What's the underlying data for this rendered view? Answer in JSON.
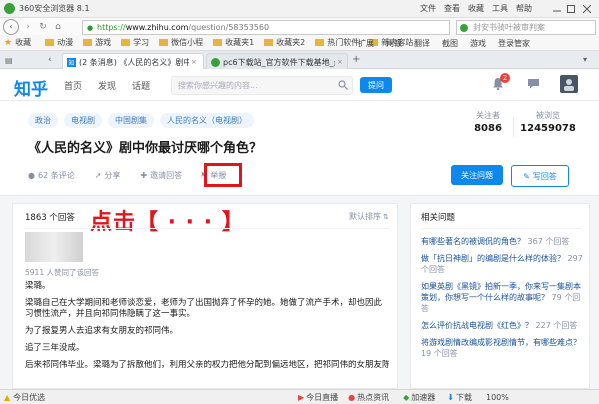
{
  "browser": {
    "title": "360安全浏览器 8.1",
    "menus": [
      "文件",
      "查看",
      "收藏",
      "工具",
      "帮助"
    ],
    "url_scheme": "https://",
    "url_domain": "www.zhihu.com",
    "url_path": "/question/58353560",
    "search_placeholder": "封安书骑叶被审判案",
    "bookmarks": [
      "收藏",
      "动漫",
      "游戏",
      "学习",
      "微信小程",
      "收藏夹1",
      "收藏夹2",
      "热门软件",
      "新内容站"
    ],
    "toolbar_right": [
      "扩展",
      "网银",
      "翻译",
      "截图",
      "游戏",
      "登录管家"
    ],
    "tabs": [
      "(2 条消息) 《人民的名义》剧中你最讨...",
      "pc6下载站_官方软件下载基地_最安..."
    ],
    "status": [
      "今日优选",
      "今日直播",
      "热点资讯",
      "加速器",
      "下载",
      "100%"
    ]
  },
  "header": {
    "logo": "知乎",
    "nav": [
      "首页",
      "发现",
      "话题"
    ],
    "search_placeholder": "搜索你感兴趣的内容...",
    "ask_button": "提问",
    "notify_count": "2"
  },
  "question": {
    "tags": [
      "政治",
      "电视剧",
      "中国剧集",
      "人民的名义（电视剧）"
    ],
    "title": "《人民的名义》剧中你最讨厌哪个角色？",
    "follower_label": "关注者",
    "follower_count": "8086",
    "view_label": "被浏览",
    "view_count": "12459078",
    "actions": [
      "62 条评论",
      "分享",
      "邀请回答",
      "举报"
    ],
    "more_label": "···",
    "follow_button": "关注问题",
    "write_button": "写回答"
  },
  "annotation": {
    "text": "点击【 · · · 】",
    "color": "#e0151d"
  },
  "answers": {
    "count": "1863 个回答",
    "sort": "默认排序",
    "likes": "5911 人赞同了该回答",
    "paragraphs": [
      "梁璐。",
      "梁璐自己在大学期间和老师谈恋爱，老师为了出国抛弃了怀孕的她。她做了流产手术，却也因此习惯性流产，并且向祁同伟隐瞒了这一事实。",
      "为了报复男人去追求有女朋友的祁同伟。",
      "追了三年没成。",
      "后来祁同伟毕业。梁璐为了拆散他们，利用父亲的权力把他分配到偏远地区，把祁同伟的女朋友陈"
    ]
  },
  "related": {
    "title": "相关问题",
    "items": [
      {
        "text": "有哪些著名的被调侃的角色？",
        "count": "367 个回答"
      },
      {
        "text": "做「抗日神剧」的编剧是什么样的体验？",
        "count": "297 个回答"
      },
      {
        "text": "如果英剧《黑镜》拍新一季，你来写一集剧本策划，你想写一个什么样的故事呢？",
        "count": "79 个回答"
      },
      {
        "text": "怎么评价抗战电视剧《红色》？",
        "count": "227 个回答"
      },
      {
        "text": "将游戏剧情改编成影视剧情节，有哪些难点？",
        "count": "19 个回答"
      }
    ]
  }
}
